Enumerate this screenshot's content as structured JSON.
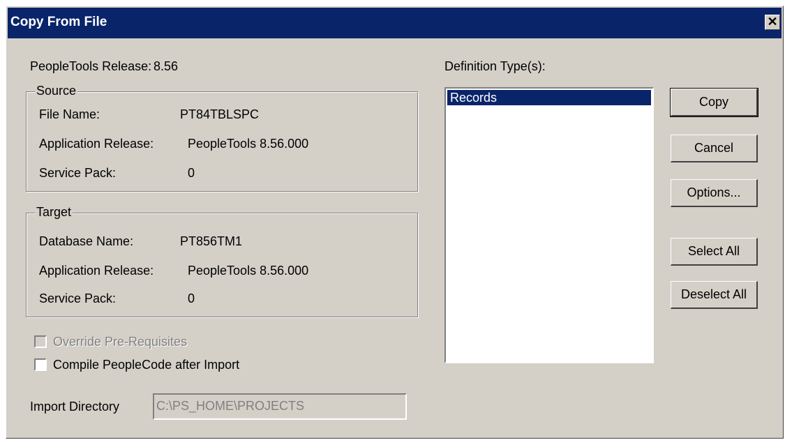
{
  "window": {
    "title": "Copy From File",
    "close_glyph": "✕"
  },
  "release": {
    "label": "PeopleTools Release:",
    "value": "8.56"
  },
  "source": {
    "title": "Source",
    "file_name_label": "File Name:",
    "file_name_value": "PT84TBLSPC",
    "app_release_label": "Application Release:",
    "app_release_value": "PeopleTools 8.56.000",
    "service_pack_label": "Service Pack:",
    "service_pack_value": "0"
  },
  "target": {
    "title": "Target",
    "db_name_label": "Database Name:",
    "db_name_value": "PT856TM1",
    "app_release_label": "Application Release:",
    "app_release_value": "PeopleTools 8.56.000",
    "service_pack_label": "Service Pack:",
    "service_pack_value": "0"
  },
  "definitions": {
    "label": "Definition Type(s):",
    "items": [
      "Records"
    ],
    "selected": "Records"
  },
  "buttons": {
    "copy": "Copy",
    "cancel": "Cancel",
    "options": "Options...",
    "select_all": "Select All",
    "deselect_all": "Deselect All"
  },
  "options": {
    "override_prereq_label": "Override Pre-Requisites",
    "override_prereq_checked": false,
    "override_prereq_enabled": false,
    "compile_peoplecode_label": "Compile PeopleCode after Import",
    "compile_peoplecode_checked": false
  },
  "import_directory": {
    "label": "Import Directory",
    "value": "C:\\PS_HOME\\PROJECTS"
  },
  "colors": {
    "titlebar": "#0a246a",
    "dialog_bg": "#d4d0c8",
    "selection": "#0a246a"
  }
}
